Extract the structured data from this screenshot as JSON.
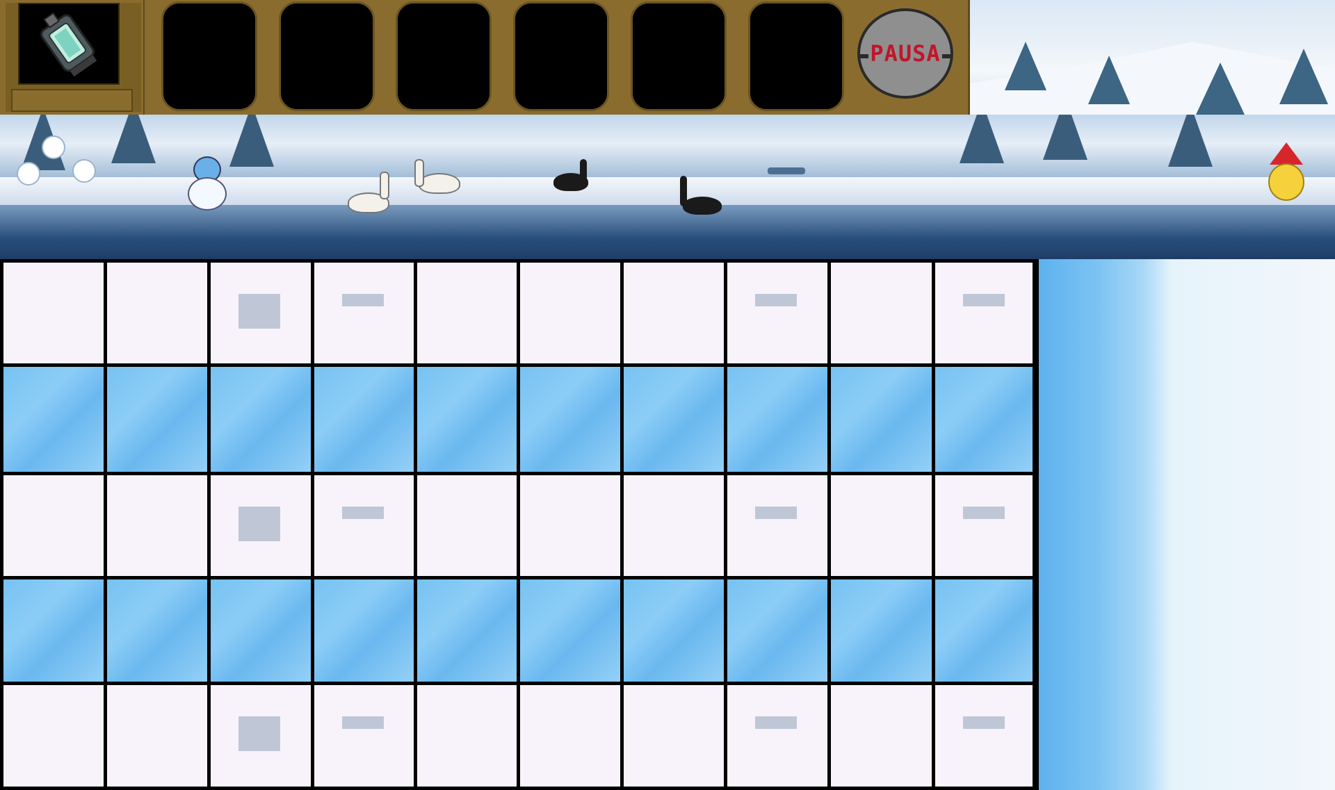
{
  "hud": {
    "selected_card": {
      "icon": "lantern-tower-icon",
      "counter": ""
    },
    "slots": [
      {
        "empty": true
      },
      {
        "empty": true
      },
      {
        "empty": true
      },
      {
        "empty": true
      },
      {
        "empty": true
      },
      {
        "empty": true
      }
    ],
    "pause_label": "PAUSA"
  },
  "scene": {
    "name": "winter-lake",
    "creatures": [
      "snow-ghost",
      "snow-ghost",
      "snow-ghost",
      "snowman",
      "white-swan",
      "white-swan",
      "black-swan",
      "black-swan",
      "boat",
      "santa-duck"
    ]
  },
  "board": {
    "rows": 5,
    "cols": 10,
    "row_types": [
      "snow",
      "ice",
      "snow",
      "ice",
      "snow"
    ]
  },
  "colors": {
    "hud_brown": "#8a6d2e",
    "pause_text": "#c0152a",
    "snow_cell": "#f8f3fa",
    "ice_cell": "#77c2f2"
  }
}
